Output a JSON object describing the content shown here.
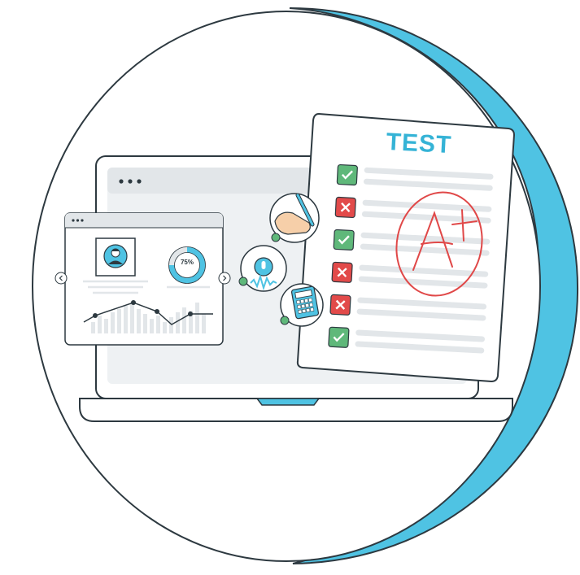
{
  "test_sheet": {
    "title": "TEST",
    "grade": "A+",
    "rows": [
      {
        "status": "correct"
      },
      {
        "status": "incorrect"
      },
      {
        "status": "correct"
      },
      {
        "status": "incorrect"
      },
      {
        "status": "incorrect"
      },
      {
        "status": "correct"
      }
    ]
  },
  "browser_card": {
    "progress_label": "75%",
    "progress_value": 0.75
  },
  "icons": {
    "correct": "check-icon",
    "incorrect": "cross-icon",
    "avatar": "user-avatar-icon",
    "mic": "microphone-icon",
    "calculator": "calculator-icon",
    "writing": "writing-hand-icon"
  },
  "colors": {
    "accent": "#4fc3e3",
    "outline": "#2d3940",
    "correct": "#5fb87a",
    "incorrect": "#e24a4a",
    "grade": "#e04848"
  }
}
